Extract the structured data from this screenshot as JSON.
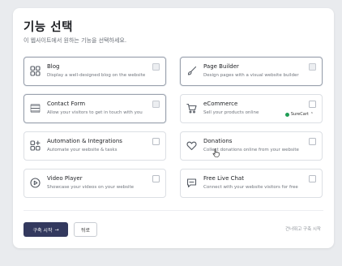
{
  "header": {
    "title": "기능 선택",
    "subtitle": "이 웹사이트에서 원하는 기능을 선택하세요."
  },
  "features": [
    {
      "name": "Blog",
      "description": "Display a well-designed blog on the website",
      "icon": "grid-icon",
      "selected": true
    },
    {
      "name": "Page Builder",
      "description": "Design pages with a visual website builder",
      "icon": "brush-icon",
      "selected": true
    },
    {
      "name": "Contact Form",
      "description": "Allow your visitors to get in touch with you",
      "icon": "form-icon",
      "selected": true
    },
    {
      "name": "eCommerce",
      "description": "Sell your products online",
      "icon": "cart-icon",
      "selected": false,
      "badge": "SureCart",
      "badge_color": "#1f9d55"
    },
    {
      "name": "Automation & Integrations",
      "description": "Automate your website & tasks",
      "icon": "apps-icon",
      "selected": false
    },
    {
      "name": "Donations",
      "description": "Collect donations online from your website",
      "icon": "heart-icon",
      "selected": false
    },
    {
      "name": "Video Player",
      "description": "Showcase your videos on your website",
      "icon": "play-icon",
      "selected": false
    },
    {
      "name": "Free Live Chat",
      "description": "Connect with your website visitors for free",
      "icon": "chat-icon",
      "selected": false
    }
  ],
  "footer": {
    "primary_label": "구축 시작",
    "primary_arrow": "→",
    "back_label": "뒤로",
    "skip_label": "건너뛰고 구축 시작"
  },
  "colors": {
    "primary": "#33395e",
    "badge_dot": "#1f9d55"
  }
}
